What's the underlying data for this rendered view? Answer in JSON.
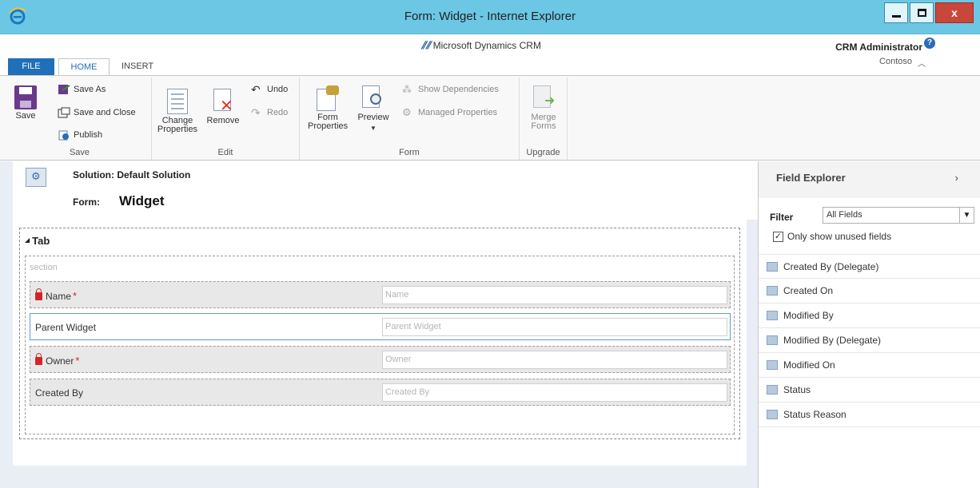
{
  "window": {
    "title": "Form: Widget - Internet Explorer",
    "close_label": "x"
  },
  "header": {
    "product": "Microsoft Dynamics CRM",
    "user": "CRM Administrator",
    "org": "Contoso"
  },
  "ribbon_tabs": [
    "FILE",
    "HOME",
    "INSERT"
  ],
  "ribbon": {
    "save_group": {
      "label": "Save",
      "save": "Save",
      "save_as": "Save As",
      "save_and_close": "Save and Close",
      "publish": "Publish"
    },
    "edit_group": {
      "label": "Edit",
      "change_properties_1": "Change",
      "change_properties_2": "Properties",
      "remove": "Remove",
      "undo": "Undo",
      "redo": "Redo"
    },
    "form_group": {
      "label": "Form",
      "form_properties_1": "Form",
      "form_properties_2": "Properties",
      "preview": "Preview",
      "show_dependencies": "Show Dependencies",
      "managed_properties": "Managed Properties"
    },
    "upgrade_group": {
      "label": "Upgrade",
      "merge_forms_1": "Merge",
      "merge_forms_2": "Forms"
    }
  },
  "form_header": {
    "solution": "Solution: Default Solution",
    "form_label": "Form:",
    "form_name": "Widget"
  },
  "canvas": {
    "tab_title": "Tab",
    "section_title": "section",
    "fields": [
      {
        "label": "Name",
        "placeholder": "Name",
        "locked": true,
        "required": true
      },
      {
        "label": "Parent Widget",
        "placeholder": "Parent Widget",
        "locked": false,
        "required": false
      },
      {
        "label": "Owner",
        "placeholder": "Owner",
        "locked": true,
        "required": true
      },
      {
        "label": "Created By",
        "placeholder": "Created By",
        "locked": false,
        "required": false
      }
    ]
  },
  "field_explorer": {
    "title": "Field Explorer",
    "filter_label": "Filter",
    "filter_value": "All Fields",
    "only_unused_label": "Only show unused fields",
    "only_unused_checked": true,
    "fields": [
      "Created By (Delegate)",
      "Created On",
      "Modified By",
      "Modified By (Delegate)",
      "Modified On",
      "Status",
      "Status Reason"
    ]
  }
}
